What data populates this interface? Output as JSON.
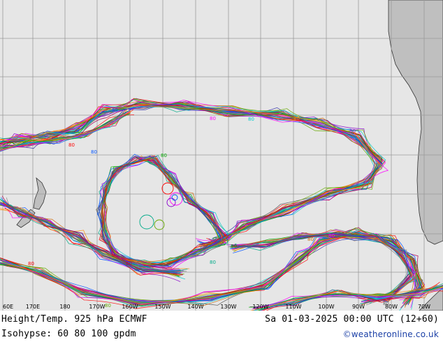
{
  "map": {
    "longitude_labels": [
      "60E",
      "170E",
      "180",
      "170W",
      "160W",
      "150W",
      "140W",
      "130W",
      "120W",
      "110W",
      "100W",
      "90W",
      "80W",
      "70W"
    ],
    "contour_label_value": "80",
    "colors": {
      "ocean": "#e6e6e6",
      "land": "#bfbfbf",
      "grid": "#9a9a9a",
      "coast": "#333333",
      "ensemble_palette": [
        "#ff0000",
        "#0055ff",
        "#00aa00",
        "#ff00ff",
        "#00cccc",
        "#ff8800",
        "#8800cc",
        "#888888",
        "#aa0055",
        "#00aa88",
        "#cc6600",
        "#3333aa",
        "#66aa00",
        "#555555"
      ]
    }
  },
  "footer": {
    "title": "Height/Temp. 925 hPa  ECMWF",
    "datetime": "Sa 01-03-2025 00:00 UTC (12+60)",
    "isohypse": "Isohypse: 60 80 100 gpdm",
    "credit": "©weatheronline.co.uk"
  }
}
